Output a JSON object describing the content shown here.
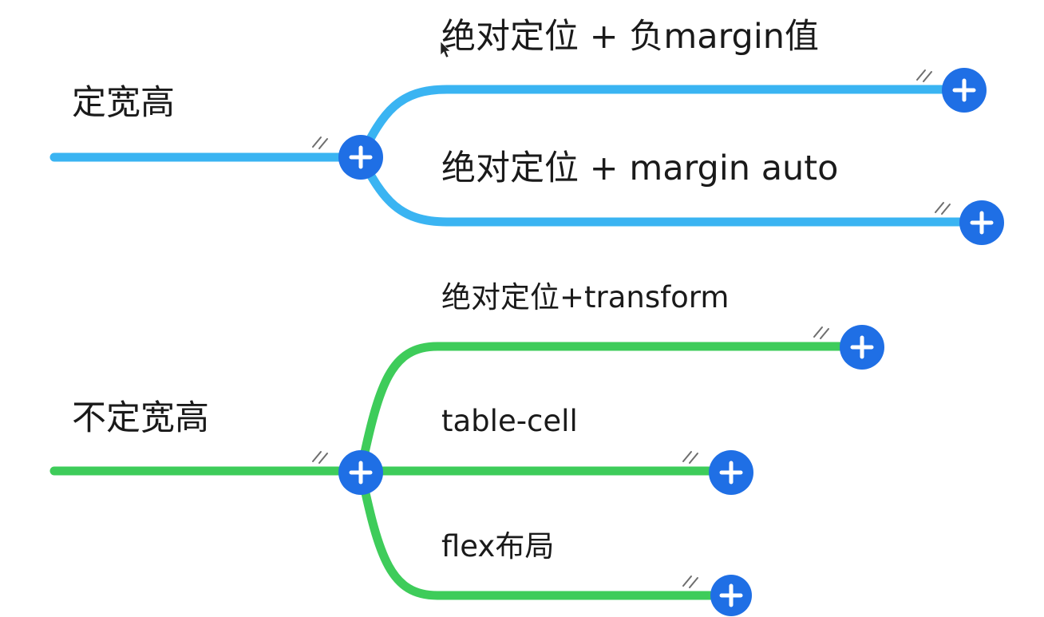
{
  "colors": {
    "branch_blue": "#3ab4f2",
    "branch_green": "#3ecc5a",
    "button_fill": "#1f6fe5",
    "text": "#1a1a1a"
  },
  "icons": {
    "expand": "plus-circle-icon",
    "collapse_marker": "double-slash-icon",
    "cursor": "mouse-pointer-icon"
  },
  "groups": [
    {
      "label": "定宽高",
      "color_key": "branch_blue",
      "children": [
        {
          "label": "绝对定位 + 负margin值"
        },
        {
          "label": "绝对定位 + margin auto"
        }
      ]
    },
    {
      "label": "不定宽高",
      "color_key": "branch_green",
      "children": [
        {
          "label": "绝对定位+transform"
        },
        {
          "label": "table-cell"
        },
        {
          "label": "flex布局"
        }
      ]
    }
  ]
}
